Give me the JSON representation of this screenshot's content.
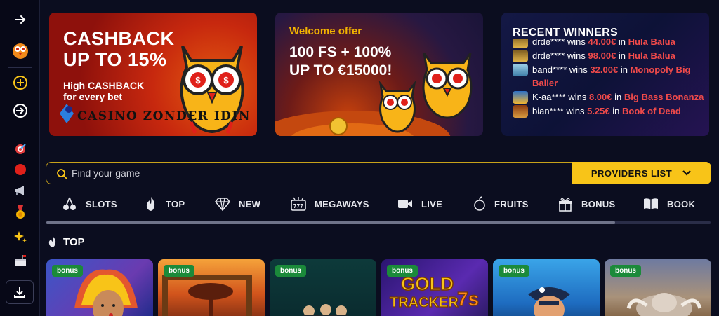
{
  "banners": {
    "cashback": {
      "title_line1": "CASHBACK",
      "title_line2": "UP TO 15%",
      "subtitle_line1": "High CASHBACK",
      "subtitle_line2": "for every bet",
      "watermark": "CASINO ZONDER IDIN"
    },
    "welcome": {
      "tag": "Welcome offer",
      "title_line1": "100 FS + 100%",
      "title_line2": "UP TO €15000!"
    },
    "winners": {
      "title": "RECENT WINNERS",
      "rows": [
        {
          "user": "drde****",
          "wins": "wins",
          "amount": "44.00€",
          "in": "in",
          "game": "Hula Balua"
        },
        {
          "user": "drde****",
          "wins": "wins",
          "amount": "98.00€",
          "in": "in",
          "game": "Hula Balua"
        },
        {
          "user": "band****",
          "wins": "wins",
          "amount": "32.00€",
          "in": "in",
          "game": "Monopoly Big Baller"
        },
        {
          "user": "K-aa****",
          "wins": "wins",
          "amount": "8.00€",
          "in": "in",
          "game": "Big Bass Bonanza"
        },
        {
          "user": "bian****",
          "wins": "wins",
          "amount": "5.25€",
          "in": "in",
          "game": "Book of Dead"
        }
      ]
    }
  },
  "search": {
    "placeholder": "Find your game",
    "providers_label": "PROVIDERS LIST"
  },
  "categories": [
    "SLOTS",
    "TOP",
    "NEW",
    "MEGAWAYS",
    "LIVE",
    "FRUITS",
    "BONUS",
    "BOOK"
  ],
  "section": {
    "title": "TOP"
  },
  "tiles": [
    {
      "badge": "bonus"
    },
    {
      "badge": "bonus"
    },
    {
      "badge": "bonus"
    },
    {
      "badge": "bonus",
      "art_text_1": "GOLD",
      "art_text_2": "TRACKER",
      "art_text_3": "7s"
    },
    {
      "badge": "bonus"
    },
    {
      "badge": "bonus"
    }
  ],
  "colors": {
    "background": "#0b0d1f",
    "accent": "#f8c418",
    "badge": "#1b8a3a",
    "win_text": "#f04a4a"
  }
}
